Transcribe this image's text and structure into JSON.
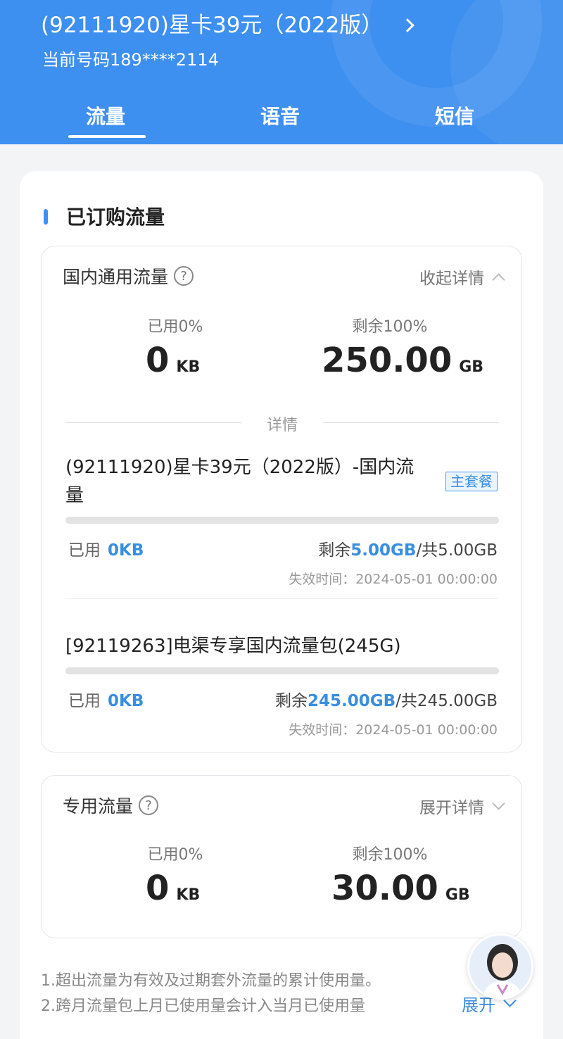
{
  "header": {
    "plan_title": "(92111920)星卡39元（2022版）",
    "phone_number": "当前号码189****2114",
    "tabs": [
      "流量",
      "语音",
      "短信"
    ],
    "active_tab": "流量"
  },
  "section": {
    "title": "已订购流量"
  },
  "domestic": {
    "title": "国内通用流量",
    "help": "?",
    "toggle": "收起详情",
    "used_label": "已用0%",
    "used_value": "0",
    "used_unit": "KB",
    "remain_label": "剩余100%",
    "remain_value": "250.00",
    "remain_unit": "GB",
    "details_divider": "详情",
    "packages": [
      {
        "name": "(92111920)星卡39元（2022版）-国内流量",
        "badge": "主套餐",
        "used_label": "已用",
        "used_value": "0KB",
        "remain_label": "剩余",
        "remain_value": "5.00GB",
        "total": "/共5.00GB",
        "used_fraction": 0,
        "expire": "失效时间：2024-05-01 00:00:00"
      },
      {
        "name": "[92119263]电渠专享国内流量包(245G)",
        "used_label": "已用",
        "used_value": "0KB",
        "remain_label": "剩余",
        "remain_value": "245.00GB",
        "total": "/共245.00GB",
        "used_fraction": 0,
        "expire": "失效时间：2024-05-01 00:00:00"
      }
    ]
  },
  "dedicated": {
    "title": "专用流量",
    "help": "?",
    "toggle": "展开详情",
    "used_label": "已用0%",
    "used_value": "0",
    "used_unit": "KB",
    "remain_label": "剩余100%",
    "remain_value": "30.00",
    "remain_unit": "GB"
  },
  "notes": {
    "line1": "1.超出流量为有效及过期套外流量的累计使用量。",
    "line2": "2.跨月流量包上月已使用量会计入当月已使用量",
    "expand": "展开"
  },
  "colors": {
    "primary": "#3d8ff0",
    "accent_text": "#3a8ee0"
  }
}
